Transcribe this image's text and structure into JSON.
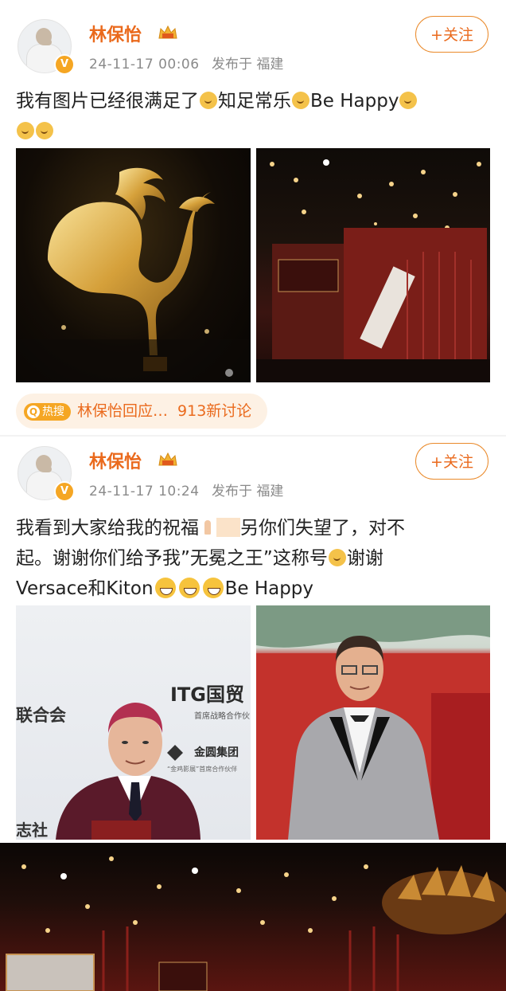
{
  "posts": [
    {
      "user": {
        "name": "林保怡",
        "badge": "V"
      },
      "meta": {
        "timestamp": "24-11-17 00:06",
        "location": "发布于 福建"
      },
      "follow_label": "+关注",
      "text": {
        "part1": "我有图片已经很满足了",
        "part2": "知足常乐",
        "part3": "Be Happy"
      },
      "hot_search": {
        "tag": "热搜",
        "tag_icon": "Q",
        "topic": "林保怡回应…",
        "count": "913新讨论"
      }
    },
    {
      "user": {
        "name": "林保怡",
        "badge": "V"
      },
      "meta": {
        "timestamp": "24-11-17 10:24",
        "location": "发布于 福建"
      },
      "follow_label": "+关注",
      "text": {
        "line1a": "我看到大家给我的祝福",
        "line1b": "另你们失望了，对不",
        "line2a": "起。谢谢你们给予我”无冕之王”这称号",
        "line2b": "谢谢",
        "line3a": "Versace和Kiton",
        "line3b": "Be Happy"
      },
      "image_text": {
        "org": "联合会",
        "itg": "ITG国贸",
        "itg_sub": "首席战略合作伙",
        "group": "金圆集团",
        "group_sub": "“金鸡影展”首席合作伙伴",
        "side": "志社"
      }
    }
  ],
  "colors": {
    "accent": "#ea6a1d",
    "meta": "#8a8a8a"
  }
}
